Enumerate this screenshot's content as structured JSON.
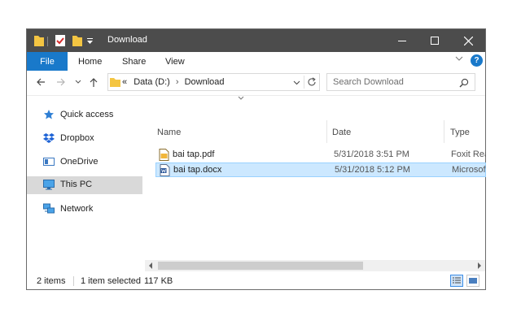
{
  "window": {
    "title": "Download",
    "controls": {
      "minimize": "minimize-icon",
      "maximize": "maximize-icon",
      "close": "close-icon"
    }
  },
  "ribbon": {
    "tabs": [
      {
        "label": "File"
      },
      {
        "label": "Home"
      },
      {
        "label": "Share"
      },
      {
        "label": "View"
      }
    ],
    "accent": "#1979ca",
    "help_label": "?"
  },
  "address": {
    "overflow": "«",
    "crumbs": [
      "Data (D:)",
      "Download"
    ],
    "separator": "›"
  },
  "search": {
    "placeholder": "Search Download"
  },
  "nav": [
    {
      "label": "Quick access",
      "icon": "star-icon"
    },
    {
      "label": "Dropbox",
      "icon": "dropbox-icon"
    },
    {
      "label": "OneDrive",
      "icon": "onedrive-icon"
    },
    {
      "label": "This PC",
      "icon": "pc-icon",
      "selected": true
    },
    {
      "label": "Network",
      "icon": "network-icon"
    }
  ],
  "columns": {
    "name": "Name",
    "date": "Date",
    "type": "Type"
  },
  "files": [
    {
      "name": "bai tap.pdf",
      "date": "5/31/2018 3:51 PM",
      "type": "Foxit Rea",
      "icon": "pdf-file-icon",
      "selected": false
    },
    {
      "name": "bai tap.docx",
      "date": "5/31/2018 5:12 PM",
      "type": "Microsof",
      "icon": "word-file-icon",
      "selected": true
    }
  ],
  "status": {
    "count": "2 items",
    "selection": "1 item selected",
    "size": "117 KB"
  }
}
